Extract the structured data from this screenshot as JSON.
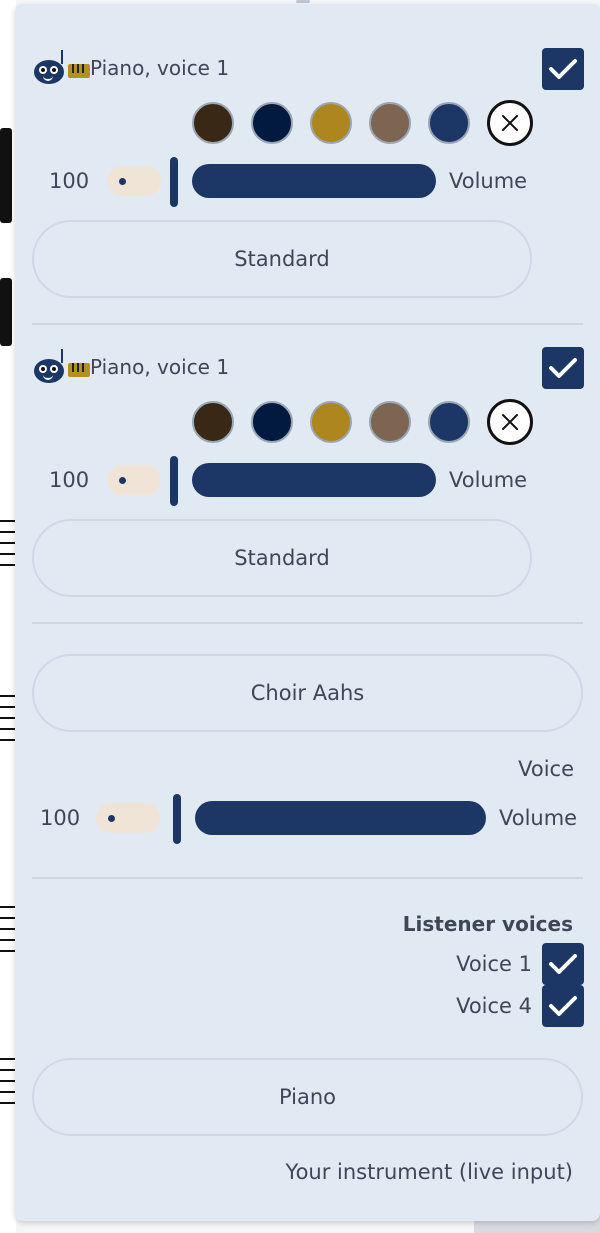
{
  "voices": [
    {
      "name": "Piano, voice 1",
      "enabled": true,
      "swatches": [
        {
          "name": "dark-brown",
          "color": "#3a2817"
        },
        {
          "name": "navy",
          "color": "#021a40"
        },
        {
          "name": "gold",
          "color": "#ad871d"
        },
        {
          "name": "taupe",
          "color": "#7e6552"
        },
        {
          "name": "blue",
          "color": "#1c3766"
        }
      ],
      "volume_value": "100",
      "volume_label": "Volume",
      "style_button": "Standard"
    },
    {
      "name": "Piano, voice 1",
      "enabled": true,
      "swatches": [
        {
          "name": "dark-brown",
          "color": "#3a2817"
        },
        {
          "name": "navy",
          "color": "#021a40"
        },
        {
          "name": "gold",
          "color": "#ad871d"
        },
        {
          "name": "taupe",
          "color": "#7e6552"
        },
        {
          "name": "blue",
          "color": "#1c3766"
        }
      ],
      "volume_value": "100",
      "volume_label": "Volume",
      "style_button": "Standard"
    }
  ],
  "voice_section": {
    "instrument_button": "Choir Aahs",
    "label": "Voice",
    "volume_value": "100",
    "volume_label": "Volume"
  },
  "listener": {
    "heading": "Listener voices",
    "items": [
      {
        "label": "Voice 1",
        "checked": true
      },
      {
        "label": "Voice 4",
        "checked": true
      }
    ]
  },
  "live_input": {
    "instrument_button": "Piano",
    "label": "Your instrument (live input)"
  },
  "colors": {
    "accent": "#1c3766",
    "panel_bg": "#e1e9f3",
    "volume_pill": "#f0e4d6"
  }
}
